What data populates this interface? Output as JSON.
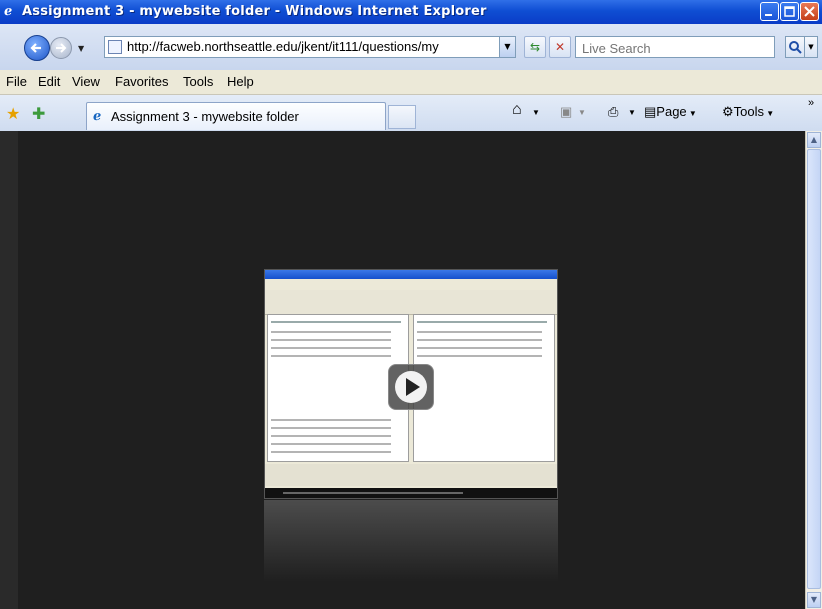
{
  "window": {
    "title": "Assignment 3 - mywebsite folder - Windows Internet Explorer"
  },
  "address": {
    "url": "http://facweb.northseattle.edu/jkent/it111/questions/my",
    "search_placeholder": "Live Search"
  },
  "menu": {
    "items": [
      "File",
      "Edit",
      "View",
      "Favorites",
      "Tools",
      "Help"
    ]
  },
  "tabs": {
    "active_label": "Assignment 3 - mywebsite folder"
  },
  "commands": {
    "page_label": "Page",
    "tools_label": "Tools"
  },
  "colors": {
    "titlebar": "#0f4ed3",
    "content_bg": "#1f1f1f"
  },
  "icons": {
    "play": "play-icon",
    "back": "back-arrow-icon",
    "forward": "forward-arrow-icon"
  }
}
